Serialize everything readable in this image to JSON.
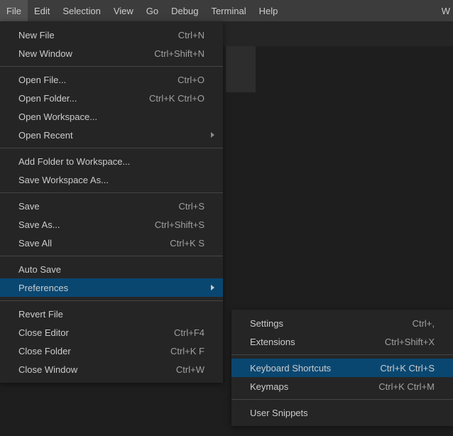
{
  "menubar": {
    "items": [
      {
        "label": "File"
      },
      {
        "label": "Edit"
      },
      {
        "label": "Selection"
      },
      {
        "label": "View"
      },
      {
        "label": "Go"
      },
      {
        "label": "Debug"
      },
      {
        "label": "Terminal"
      },
      {
        "label": "Help"
      }
    ],
    "right": "W"
  },
  "fileMenu": {
    "groups": [
      [
        {
          "label": "New File",
          "shortcut": "Ctrl+N"
        },
        {
          "label": "New Window",
          "shortcut": "Ctrl+Shift+N"
        }
      ],
      [
        {
          "label": "Open File...",
          "shortcut": "Ctrl+O"
        },
        {
          "label": "Open Folder...",
          "shortcut": "Ctrl+K Ctrl+O"
        },
        {
          "label": "Open Workspace..."
        },
        {
          "label": "Open Recent",
          "submenu": true
        }
      ],
      [
        {
          "label": "Add Folder to Workspace..."
        },
        {
          "label": "Save Workspace As..."
        }
      ],
      [
        {
          "label": "Save",
          "shortcut": "Ctrl+S"
        },
        {
          "label": "Save As...",
          "shortcut": "Ctrl+Shift+S"
        },
        {
          "label": "Save All",
          "shortcut": "Ctrl+K S"
        }
      ],
      [
        {
          "label": "Auto Save"
        },
        {
          "label": "Preferences",
          "submenu": true,
          "highlighted": true
        }
      ],
      [
        {
          "label": "Revert File"
        },
        {
          "label": "Close Editor",
          "shortcut": "Ctrl+F4"
        },
        {
          "label": "Close Folder",
          "shortcut": "Ctrl+K F"
        },
        {
          "label": "Close Window",
          "shortcut": "Ctrl+W"
        }
      ]
    ]
  },
  "prefMenu": {
    "groups": [
      [
        {
          "label": "Settings",
          "shortcut": "Ctrl+,"
        },
        {
          "label": "Extensions",
          "shortcut": "Ctrl+Shift+X"
        }
      ],
      [
        {
          "label": "Keyboard Shortcuts",
          "shortcut": "Ctrl+K Ctrl+S",
          "highlighted": true
        },
        {
          "label": "Keymaps",
          "shortcut": "Ctrl+K Ctrl+M"
        }
      ],
      [
        {
          "label": "User Snippets"
        }
      ]
    ]
  }
}
